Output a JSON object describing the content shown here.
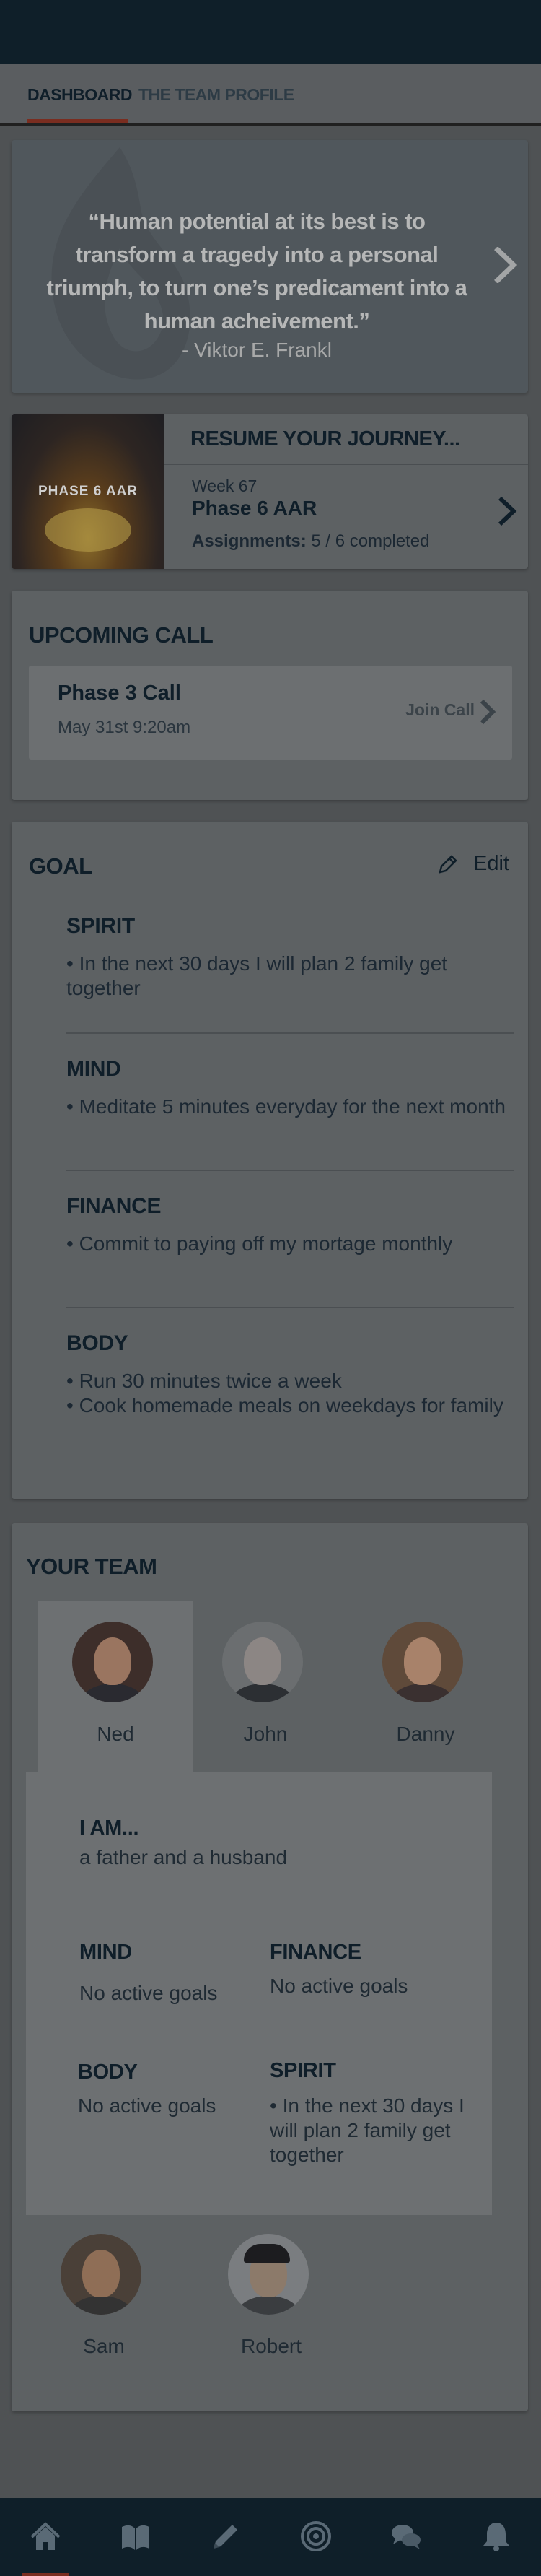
{
  "tabs": {
    "dashboard": "DASHBOARD",
    "team_profile": "THE TEAM PROFILE"
  },
  "quote": {
    "text": "“Human potential at its best is to transform a tragedy into a personal triumph, to turn one’s predicament into a human acheivement.”",
    "author": "- Viktor E. Frankl"
  },
  "resume": {
    "heading": "RESUME YOUR JOURNEY...",
    "image_label": "PHASE 6 AAR",
    "week": "Week 67",
    "phase": "Phase 6 AAR",
    "assignments_label": "Assignments:",
    "assignments_value": "5 / 6 completed"
  },
  "upcoming_call": {
    "title": "UPCOMING CALL",
    "name": "Phase 3 Call",
    "time": "May 31st  9:20am",
    "join_label": "Join Call"
  },
  "goal": {
    "title": "GOAL",
    "edit_label": "Edit",
    "sections": [
      {
        "title": "SPIRIT",
        "lines": [
          "• In the next 30 days I will plan 2 family get together"
        ]
      },
      {
        "title": "MIND",
        "lines": [
          "• Meditate 5 minutes everyday for the next month"
        ]
      },
      {
        "title": "FINANCE",
        "lines": [
          "• Commit to paying off my mortage monthly"
        ]
      },
      {
        "title": "BODY",
        "lines": [
          "• Run 30 minutes twice a week",
          "• Cook homemade meals on weekdays for family"
        ]
      }
    ]
  },
  "team": {
    "title": "YOUR TEAM",
    "members": [
      {
        "name": "Ned",
        "selected": true
      },
      {
        "name": "John",
        "selected": false
      },
      {
        "name": "Danny",
        "selected": false
      },
      {
        "name": "Sam",
        "selected": false
      },
      {
        "name": "Robert",
        "selected": false
      }
    ],
    "detail": {
      "i_am_label": "I AM...",
      "i_am_value": "a father and a husband",
      "mind_label": "MIND",
      "mind_value": "No active goals",
      "finance_label": "FINANCE",
      "finance_value": "No active goals",
      "body_label": "BODY",
      "body_value": "No active goals",
      "spirit_label": "SPIRIT",
      "spirit_value": "• In the next 30 days I will plan 2 family get together"
    }
  },
  "bottom_nav": {
    "items": [
      "home-icon",
      "book-icon",
      "pencil-icon",
      "target-icon",
      "chat-icon",
      "bell-icon"
    ],
    "active": "home-icon"
  },
  "colors": {
    "nav_bg": "#0f1f29",
    "accent": "#7a2d20",
    "overlay_bg": "#4f5254"
  }
}
